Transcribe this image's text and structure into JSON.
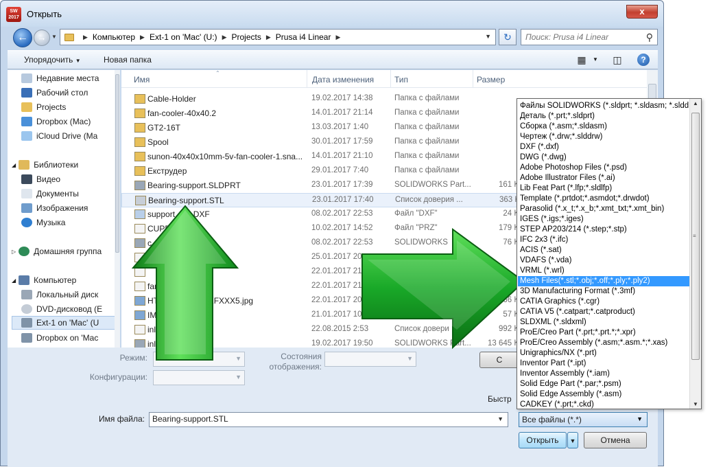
{
  "window": {
    "title": "Открыть",
    "app_badge": "2017",
    "close_label": "x"
  },
  "nav": {
    "breadcrumb": [
      "Компьютер",
      "Ext-1 on 'Mac' (U:)",
      "Projects",
      "Prusa i4 Linear"
    ],
    "search_placeholder": "Поиск: Prusa i4 Linear"
  },
  "toolbar": {
    "organize_label": "Упорядочить",
    "new_folder_label": "Новая папка"
  },
  "sidebar": {
    "favorites": [
      "Недавние места",
      "Рабочий стол",
      "Projects",
      "Dropbox (Mac)",
      "iCloud Drive (Ma"
    ],
    "libraries_header": "Библиотеки",
    "libraries": [
      "Видео",
      "Документы",
      "Изображения",
      "Музыка"
    ],
    "homegroup": "Домашняя группа",
    "computer_header": "Компьютер",
    "computer": [
      "Локальный диск",
      "DVD-дисковод (E",
      "Ext-1 on 'Mac' (U",
      "Dropbox on 'Mac"
    ],
    "selected": "Ext-1 on 'Mac' (U"
  },
  "columns": {
    "name": "Имя",
    "date": "Дата изменения",
    "type": "Тип",
    "size": "Размер"
  },
  "files": [
    {
      "name": "Cable-Holder",
      "date": "19.02.2017 14:38",
      "type": "Папка с файлами",
      "size": "",
      "icon": "folder-icon"
    },
    {
      "name": "fan-cooler-40x40.2",
      "date": "14.01.2017 21:14",
      "type": "Папка с файлами",
      "size": "",
      "icon": "folder-icon"
    },
    {
      "name": "GT2-16T",
      "date": "13.03.2017 1:40",
      "type": "Папка с файлами",
      "size": "",
      "icon": "folder-icon"
    },
    {
      "name": "Spool",
      "date": "30.01.2017 17:59",
      "type": "Папка с файлами",
      "size": "",
      "icon": "folder-icon"
    },
    {
      "name": "sunon-40x40x10mm-5v-fan-cooler-1.sna...",
      "date": "14.01.2017 21:10",
      "type": "Папка с файлами",
      "size": "",
      "icon": "folder-icon"
    },
    {
      "name": "Екструдер",
      "date": "29.01.2017 7:40",
      "type": "Папка с файлами",
      "size": "",
      "icon": "folder-icon"
    },
    {
      "name": "Bearing-support.SLDPRT",
      "date": "23.01.2017 17:39",
      "type": "SOLIDWORKS Part...",
      "size": "161 K",
      "icon": "sldprt-icon"
    },
    {
      "name": "Bearing-support.STL",
      "date": "23.01.2017 17:40",
      "type": "Список доверия ...",
      "size": "363 K",
      "icon": "stl-file-icon"
    },
    {
      "name": "support...b1.DXF",
      "date": "08.02.2017 22:53",
      "type": "Файл \"DXF\"",
      "size": "24 K",
      "icon": "dxf-icon"
    },
    {
      "name": "CUPP...B1.prz",
      "date": "10.02.2017 14:52",
      "type": "Файл \"PRZ\"",
      "size": "179 K",
      "icon": "file-icon"
    },
    {
      "name": "c...PRT",
      "date": "08.02.2017 22:53",
      "type": "SOLIDWORKS",
      "size": "76 K",
      "icon": "sldprt-icon"
    },
    {
      "name": "",
      "date": "25.01.2017 20",
      "type": "",
      "size": "",
      "icon": "file-icon"
    },
    {
      "name": "",
      "date": "22.01.2017 21",
      "type": "",
      "size": "",
      "icon": "file-icon"
    },
    {
      "name": "fan",
      "date": "22.01.2017 21",
      "type": "",
      "size": "",
      "icon": "file-icon"
    },
    {
      "name": "HT...b4XFXXq6xXFXXX5.jpg",
      "date": "22.01.2017 20",
      "type": "",
      "size": "166 K",
      "icon": "image-icon"
    },
    {
      "name": "IM",
      "date": "21.01.2017 10:05",
      "type": "Рисунок PNG",
      "size": "57 K",
      "icon": "image-icon"
    },
    {
      "name": "inl",
      "date": "22.08.2015 2:53",
      "type": "Список довери",
      "size": "992 K",
      "icon": "file-icon"
    },
    {
      "name": "inl...RT",
      "date": "19.02.2017 19:50",
      "type": "SOLIDWORKS Part...",
      "size": "13 645 K",
      "icon": "sldprt-icon"
    }
  ],
  "bottom": {
    "mode_label": "Режим:",
    "config_label": "Конфигурации:",
    "states_label": "Состояния отображения:",
    "quick_label": "Быстр",
    "filename_label": "Имя файла:",
    "filename_value": "Bearing-support.STL",
    "filetype_value": "Все файлы (*.*)",
    "open_button": "Открыть",
    "cancel_button": "Отмена",
    "hidden_button": "С"
  },
  "filetypes": [
    "Файлы SOLIDWORKS (*.sldprt; *.sldasm; *.slddr",
    "Деталь (*.prt;*.sldprt)",
    "Сборка (*.asm;*.sldasm)",
    "Чертеж (*.drw;*.slddrw)",
    "DXF (*.dxf)",
    "DWG (*.dwg)",
    "Adobe Photoshop Files (*.psd)",
    "Adobe Illustrator Files (*.ai)",
    "Lib Feat Part (*.lfp;*.sldlfp)",
    "Template (*.prtdot;*.asmdot;*.drwdot)",
    "Parasolid (*.x_t;*.x_b;*.xmt_txt;*.xmt_bin)",
    "IGES (*.igs;*.iges)",
    "STEP AP203/214 (*.step;*.stp)",
    "IFC 2x3 (*.ifc)",
    "ACIS (*.sat)",
    "VDAFS (*.vda)",
    "VRML (*.wrl)",
    "Mesh Files(*.stl;*.obj;*.off;*.ply;*.ply2)",
    "3D Manufacturing Format (*.3mf)",
    "CATIA Graphics (*.cgr)",
    "CATIA V5 (*.catpart;*.catproduct)",
    "SLDXML (*.sldxml)",
    "ProE/Creo Part (*.prt;*.prt.*;*.xpr)",
    "ProE/Creo Assembly (*.asm;*.asm.*;*.xas)",
    "Unigraphics/NX (*.prt)",
    "Inventor Part (*.ipt)",
    "Inventor Assembly (*.iam)",
    "Solid Edge Part (*.par;*.psm)",
    "Solid Edge Assembly (*.asm)",
    "CADKEY (*.prt;*.ckd)"
  ],
  "highlighted_filetype_index": 17,
  "colors": {
    "accent": "#3399ff",
    "arrow_green": "#2db82d",
    "folder": "#e8c05a"
  }
}
